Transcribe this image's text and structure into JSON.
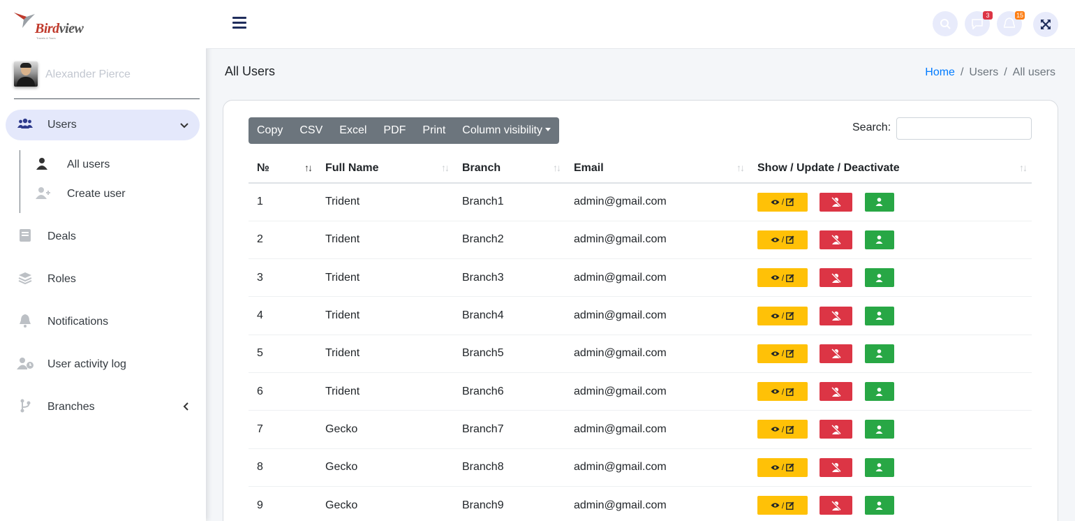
{
  "brand": {
    "name_main": "Bird",
    "name_accent": "view",
    "tagline": "Travels & Tours"
  },
  "user": {
    "name": "Alexander Pierce"
  },
  "sidebar": {
    "items": [
      {
        "label": "Users",
        "icon": "users-icon",
        "active": true,
        "expanded": true
      },
      {
        "label": "Deals",
        "icon": "book-icon"
      },
      {
        "label": "Roles",
        "icon": "layers-icon"
      },
      {
        "label": "Notifications",
        "icon": "bell-icon"
      },
      {
        "label": "User activity log",
        "icon": "user-clock-icon"
      },
      {
        "label": "Branches",
        "icon": "branch-icon"
      }
    ],
    "subitems": [
      {
        "label": "All users",
        "icon": "user-icon"
      },
      {
        "label": "Create user",
        "icon": "user-plus-icon"
      }
    ]
  },
  "topbar": {
    "messages_badge": "3",
    "notifications_badge": "15"
  },
  "page": {
    "title": "All Users",
    "breadcrumb": [
      "Home",
      "Users",
      "All users"
    ]
  },
  "toolbar": {
    "buttons": [
      "Copy",
      "CSV",
      "Excel",
      "PDF",
      "Print",
      "Column visibility"
    ],
    "search_label": "Search:",
    "search_value": ""
  },
  "table": {
    "headers": [
      "№",
      "Full Name",
      "Branch",
      "Email",
      "Show / Update / Deactivate"
    ],
    "view_label": "/",
    "rows": [
      {
        "no": "1",
        "name": "Trident",
        "branch": "Branch1",
        "email": "admin@gmail.com"
      },
      {
        "no": "2",
        "name": "Trident",
        "branch": "Branch2",
        "email": "admin@gmail.com"
      },
      {
        "no": "3",
        "name": "Trident",
        "branch": "Branch3",
        "email": "admin@gmail.com"
      },
      {
        "no": "4",
        "name": "Trident",
        "branch": "Branch4",
        "email": "admin@gmail.com"
      },
      {
        "no": "5",
        "name": "Trident",
        "branch": "Branch5",
        "email": "admin@gmail.com"
      },
      {
        "no": "6",
        "name": "Trident",
        "branch": "Branch6",
        "email": "admin@gmail.com"
      },
      {
        "no": "7",
        "name": "Gecko",
        "branch": "Branch7",
        "email": "admin@gmail.com"
      },
      {
        "no": "8",
        "name": "Gecko",
        "branch": "Branch8",
        "email": "admin@gmail.com"
      },
      {
        "no": "9",
        "name": "Gecko",
        "branch": "Branch9",
        "email": "admin@gmail.com"
      }
    ]
  },
  "colors": {
    "view_button": "#ffc107",
    "deactivate_button": "#dc3545",
    "activate_button": "#28a745",
    "active_nav_bg": "#e4e8fb",
    "link": "#007bff"
  }
}
